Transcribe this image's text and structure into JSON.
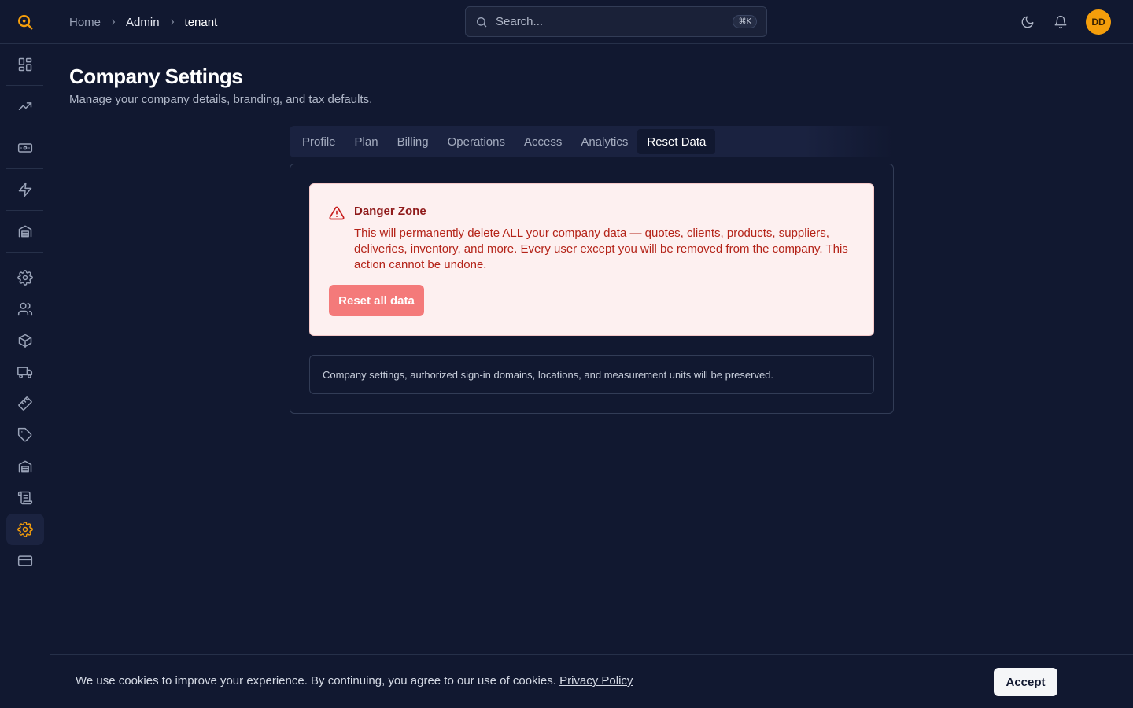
{
  "app": {
    "logo_icon": "search-logo-icon",
    "brand_color": "#f59e0b"
  },
  "sidebar": {
    "items": [
      {
        "icon": "dashboard-icon"
      },
      {
        "icon": "trending-up-icon"
      },
      {
        "icon": "banknote-icon"
      },
      {
        "icon": "lightning-icon"
      },
      {
        "icon": "warehouse-icon"
      },
      {
        "icon": "settings-icon"
      },
      {
        "icon": "users-icon"
      },
      {
        "icon": "package-icon"
      },
      {
        "icon": "truck-icon"
      },
      {
        "icon": "ruler-icon"
      },
      {
        "icon": "tag-icon"
      },
      {
        "icon": "warehouse-icon"
      },
      {
        "icon": "scroll-icon"
      },
      {
        "icon": "settings-icon",
        "active": true
      },
      {
        "icon": "credit-card-icon"
      }
    ]
  },
  "breadcrumb": {
    "home": "Home",
    "admin": "Admin",
    "current": "tenant"
  },
  "search": {
    "placeholder": "Search...",
    "shortcut": "⌘K"
  },
  "header": {
    "avatar_initials": "DD"
  },
  "page": {
    "title": "Company Settings",
    "subtitle": "Manage your company details, branding, and tax defaults."
  },
  "tabs": [
    "Profile",
    "Plan",
    "Billing",
    "Operations",
    "Access",
    "Analytics",
    "Reset Data"
  ],
  "active_tab": "Reset Data",
  "danger_zone": {
    "title": "Danger Zone",
    "text": "This will permanently delete ALL your company data — quotes, clients, products, suppliers, deliveries, inventory, and more. Every user except you will be removed from the company. This action cannot be undone.",
    "button_label": "Reset all data"
  },
  "note": "Company settings, authorized sign-in domains, locations, and measurement units will be preserved.",
  "cookie": {
    "text": "We use cookies to improve your experience. By continuing, you agree to our use of cookies.",
    "link": "Privacy Policy",
    "accept_label": "Accept"
  }
}
